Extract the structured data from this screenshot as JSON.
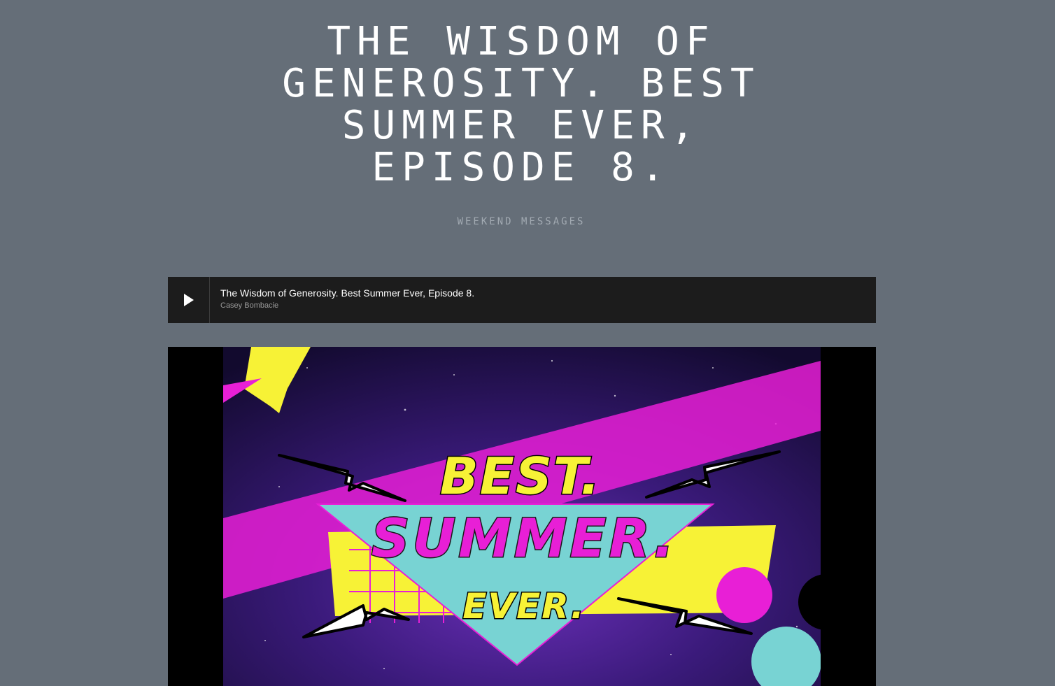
{
  "page": {
    "title": "The Wisdom of Generosity. Best Summer Ever, Episode 8.",
    "category": "Weekend Messages"
  },
  "audio_player": {
    "play_icon": "play-icon",
    "track_title": "The Wisdom of Generosity. Best Summer Ever, Episode 8.",
    "track_artist": "Casey Bombacie"
  },
  "video": {
    "artwork": {
      "line1": "BEST.",
      "line2": "SUMMER.",
      "line3": "EVER."
    }
  },
  "colors": {
    "background": "#656e78",
    "player_bg": "#1c1c1c",
    "accent_magenta": "#e81fd6",
    "accent_yellow": "#f7f236",
    "accent_teal": "#78d3d3"
  }
}
